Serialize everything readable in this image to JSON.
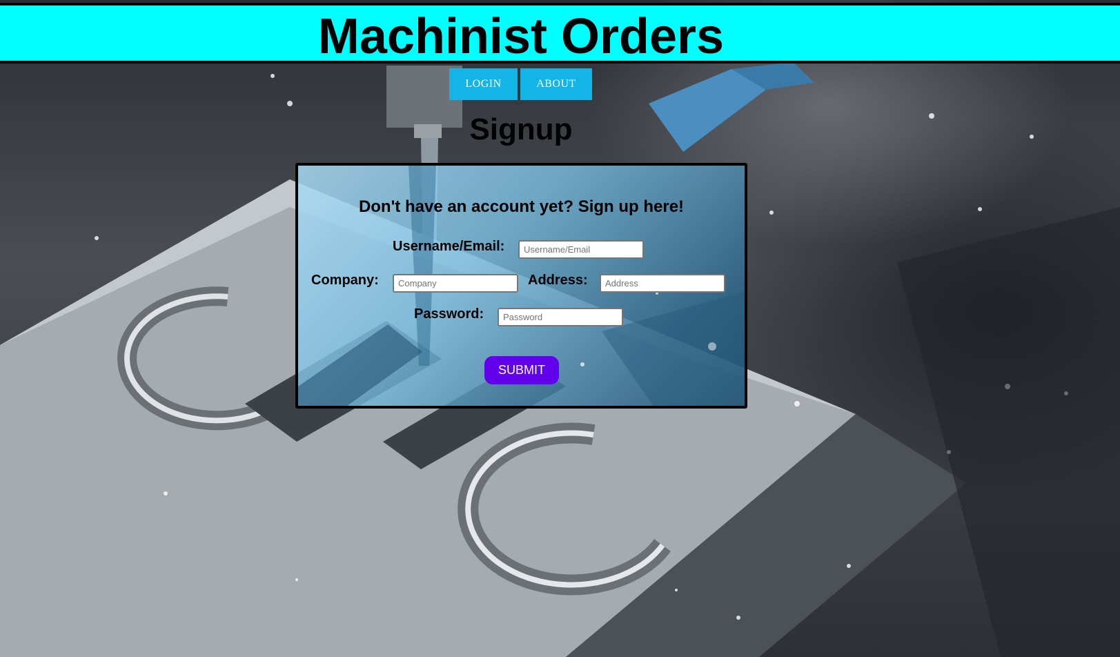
{
  "header": {
    "title": "Machinist Orders"
  },
  "nav": {
    "login_label": "LOGIN",
    "about_label": "ABOUT"
  },
  "page": {
    "heading": "Signup"
  },
  "form": {
    "subtitle": "Don't have an account yet? Sign up here!",
    "username": {
      "label": "Username/Email:",
      "placeholder": "Username/Email",
      "value": ""
    },
    "company": {
      "label": "Company:",
      "placeholder": "Company",
      "value": ""
    },
    "address": {
      "label": "Address:",
      "placeholder": "Address",
      "value": ""
    },
    "password": {
      "label": "Password:",
      "placeholder": "Password",
      "value": ""
    },
    "submit_label": "SUBMIT"
  },
  "colors": {
    "header_bg": "#00ffff",
    "nav_bg": "#12b5e6",
    "submit_bg": "#6200ee"
  }
}
